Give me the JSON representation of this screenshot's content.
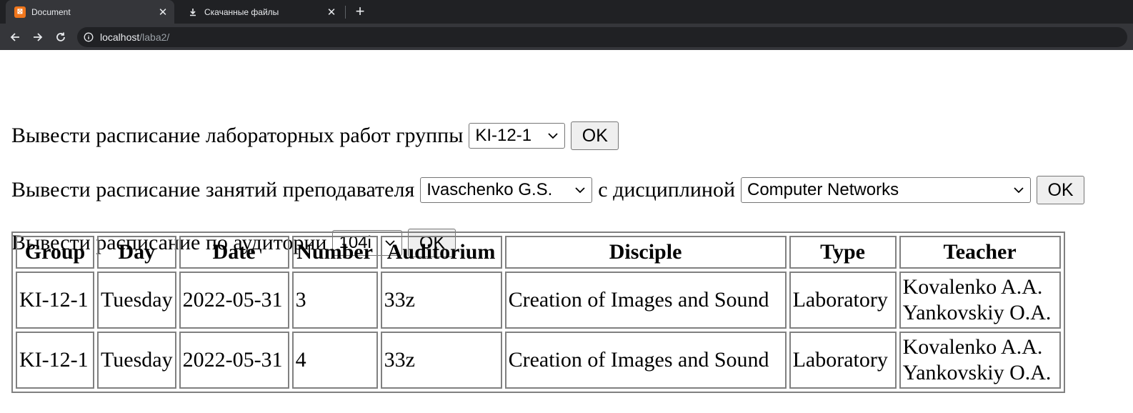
{
  "browser": {
    "tabs": [
      {
        "title": "Document",
        "favicon": "xampp-icon",
        "active": true
      },
      {
        "title": "Скачанные файлы",
        "favicon": "download-icon",
        "active": false
      }
    ],
    "url_host": "localhost",
    "url_path": "/laba2/"
  },
  "form_group": {
    "label": "Вывести расписание лабораторных работ группы",
    "select_value": "KI-12-1",
    "ok_label": "OK"
  },
  "form_teacher": {
    "label": "Вывести расписание занятий преподавателя",
    "teacher_value": "Ivaschenko G.S.",
    "mid_label": "с дисциплиной",
    "discipline_value": "Computer Networks",
    "ok_label": "OK"
  },
  "form_room": {
    "label": "Вывести расписание по аудитории",
    "select_value": "104i",
    "ok_label": "OK"
  },
  "table": {
    "headers": [
      "Group",
      "Day",
      "Date",
      "Number",
      "Auditorium",
      "Disciple",
      "Type",
      "Teacher"
    ],
    "rows": [
      {
        "group": "KI-12-1",
        "day": "Tuesday",
        "date": "2022-05-31",
        "number": "3",
        "auditorium": "33z",
        "disciple": "Creation of Images and Sound",
        "type": "Laboratory",
        "teacher1": "Kovalenko A.A.",
        "teacher2": "Yankovskiy O.A."
      },
      {
        "group": "KI-12-1",
        "day": "Tuesday",
        "date": "2022-05-31",
        "number": "4",
        "auditorium": "33z",
        "disciple": "Creation of Images and Sound",
        "type": "Laboratory",
        "teacher1": "Kovalenko A.A.",
        "teacher2": "Yankovskiy O.A."
      }
    ]
  }
}
